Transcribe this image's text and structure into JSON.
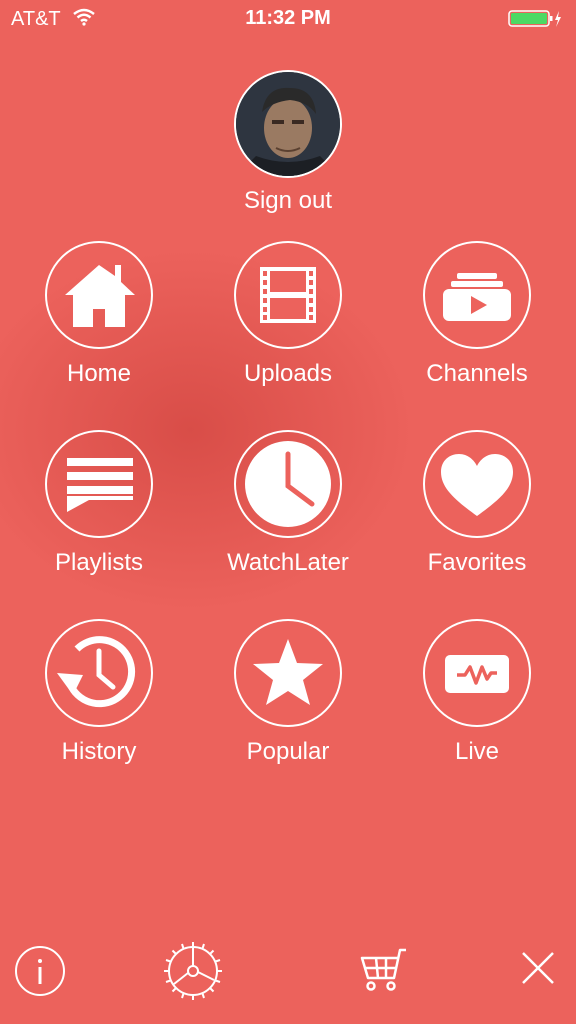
{
  "status_bar": {
    "carrier": "AT&T",
    "time": "11:32 PM",
    "battery_color": "#4cd964"
  },
  "profile": {
    "sign_out_label": "Sign out"
  },
  "menu": {
    "items": [
      {
        "label": "Home",
        "icon": "home-icon"
      },
      {
        "label": "Uploads",
        "icon": "film-icon"
      },
      {
        "label": "Channels",
        "icon": "channels-icon"
      },
      {
        "label": "Playlists",
        "icon": "playlist-icon"
      },
      {
        "label": "WatchLater",
        "icon": "clock-icon"
      },
      {
        "label": "Favorites",
        "icon": "heart-icon"
      },
      {
        "label": "History",
        "icon": "history-icon"
      },
      {
        "label": "Popular",
        "icon": "star-icon"
      },
      {
        "label": "Live",
        "icon": "live-icon"
      }
    ]
  },
  "toolbar": {
    "icons": [
      "info-icon",
      "settings-wheel-icon",
      "cart-icon",
      "close-icon"
    ]
  },
  "colors": {
    "background": "#ec625c",
    "foreground": "#ffffff"
  }
}
